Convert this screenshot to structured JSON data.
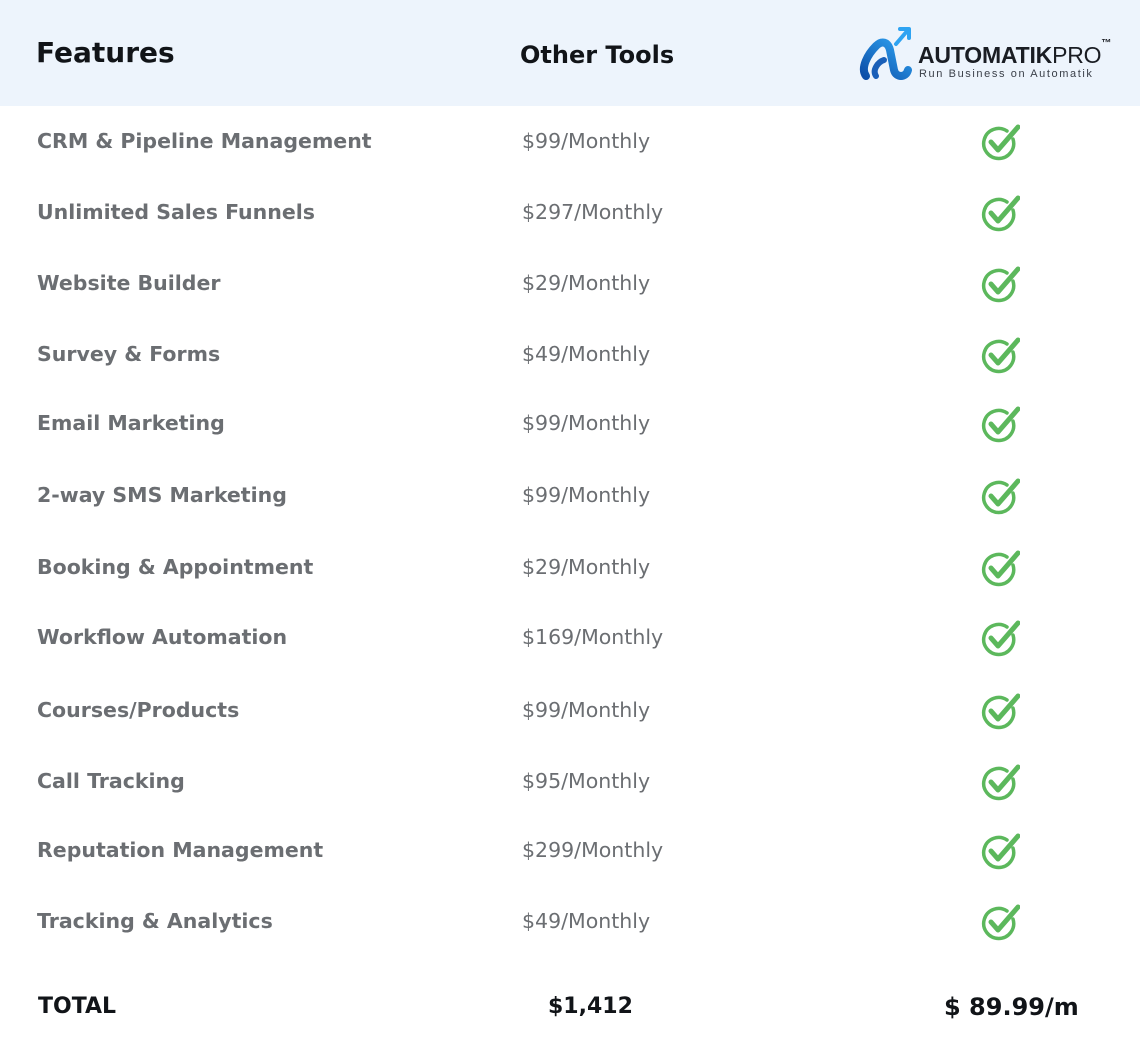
{
  "header": {
    "features_label": "Features",
    "other_tools_label": "Other Tools",
    "brand": {
      "name_bold": "AUTOMATIK",
      "name_light": "PRO",
      "trademark": "™",
      "tagline": "Run Business on Automatik",
      "logo_icon": "automatik-logo-mark",
      "accent_color": "#1f7fd6"
    }
  },
  "rows": [
    {
      "feature": "CRM & Pipeline Management",
      "price": "$99/Monthly"
    },
    {
      "feature": "Unlimited Sales Funnels",
      "price": "$297/Monthly"
    },
    {
      "feature": "Website Builder",
      "price": "$29/Monthly"
    },
    {
      "feature": "Survey & Forms",
      "price": "$49/Monthly"
    },
    {
      "feature": "Email Marketing",
      "price": "$99/Monthly"
    },
    {
      "feature": "2-way SMS Marketing",
      "price": "$99/Monthly"
    },
    {
      "feature": "Booking & Appointment",
      "price": "$29/Monthly"
    },
    {
      "feature": "Workflow Automation",
      "price": "$169/Monthly"
    },
    {
      "feature": "Courses/Products",
      "price": "$99/Monthly"
    },
    {
      "feature": "Call Tracking",
      "price": "$95/Monthly"
    },
    {
      "feature": "Reputation Management",
      "price": "$299/Monthly"
    },
    {
      "feature": "Tracking & Analytics",
      "price": "$49/Monthly"
    }
  ],
  "included_icon": "green-check-circle-icon",
  "check_color": "#5cb85c",
  "total": {
    "label": "TOTAL",
    "other_tools": "$1,412",
    "automatik": "$ 89.99/m"
  }
}
